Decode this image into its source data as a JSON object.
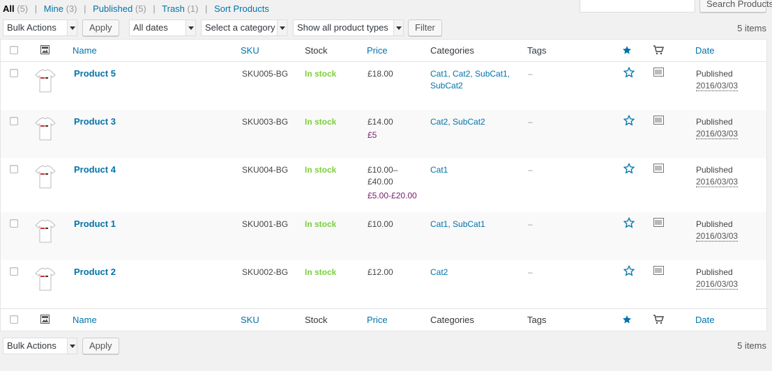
{
  "views": [
    {
      "label": "All",
      "count": "(5)",
      "current": true
    },
    {
      "label": "Mine",
      "count": "(3)",
      "current": false
    },
    {
      "label": "Published",
      "count": "(5)",
      "current": false
    },
    {
      "label": "Trash",
      "count": "(1)",
      "current": false
    },
    {
      "label": "Sort Products",
      "count": "",
      "current": false
    }
  ],
  "search": {
    "button_label": "Search Products",
    "value": ""
  },
  "filters": {
    "bulk_actions": "Bulk Actions",
    "apply": "Apply",
    "dates": "All dates",
    "category": "Select a category",
    "product_type": "Show all product types",
    "filter": "Filter"
  },
  "items_count": "5 items",
  "columns": {
    "name": "Name",
    "sku": "SKU",
    "stock": "Stock",
    "price": "Price",
    "categories": "Categories",
    "tags": "Tags",
    "date": "Date"
  },
  "rows": [
    {
      "name": "Product 5",
      "sku": "SKU005-BG",
      "stock": "In stock",
      "price_lines": [
        "£18.00"
      ],
      "sale_price": "",
      "categories": "Cat1, Cat2, SubCat1,",
      "categories_2": "SubCat2",
      "tags": "–",
      "status": "Published",
      "date": "2016/03/03"
    },
    {
      "name": "Product 3",
      "sku": "SKU003-BG",
      "stock": "In stock",
      "price_lines": [
        "£14.00"
      ],
      "sale_price": "£5",
      "categories": "Cat2, SubCat2",
      "categories_2": "",
      "tags": "–",
      "status": "Published",
      "date": "2016/03/03"
    },
    {
      "name": "Product 4",
      "sku": "SKU004-BG",
      "stock": "In stock",
      "price_lines": [
        "£10.00–",
        "£40.00"
      ],
      "sale_price": "£5.00-£20.00",
      "categories": "Cat1",
      "categories_2": "",
      "tags": "–",
      "status": "Published",
      "date": "2016/03/03"
    },
    {
      "name": "Product 1",
      "sku": "SKU001-BG",
      "stock": "In stock",
      "price_lines": [
        "£10.00"
      ],
      "sale_price": "",
      "categories": "Cat1, SubCat1",
      "categories_2": "",
      "tags": "–",
      "status": "Published",
      "date": "2016/03/03"
    },
    {
      "name": "Product 2",
      "sku": "SKU002-BG",
      "stock": "In stock",
      "price_lines": [
        "£12.00"
      ],
      "sale_price": "",
      "categories": "Cat2",
      "categories_2": "",
      "tags": "–",
      "status": "Published",
      "date": "2016/03/03"
    }
  ],
  "colors": {
    "link": "#0073aa",
    "in_stock": "#7ad03a",
    "sale": "#77216f"
  },
  "icons": {
    "image_column": "image-icon",
    "featured": "star-icon",
    "type": "cart-icon",
    "row_type": "barcode-icon"
  }
}
